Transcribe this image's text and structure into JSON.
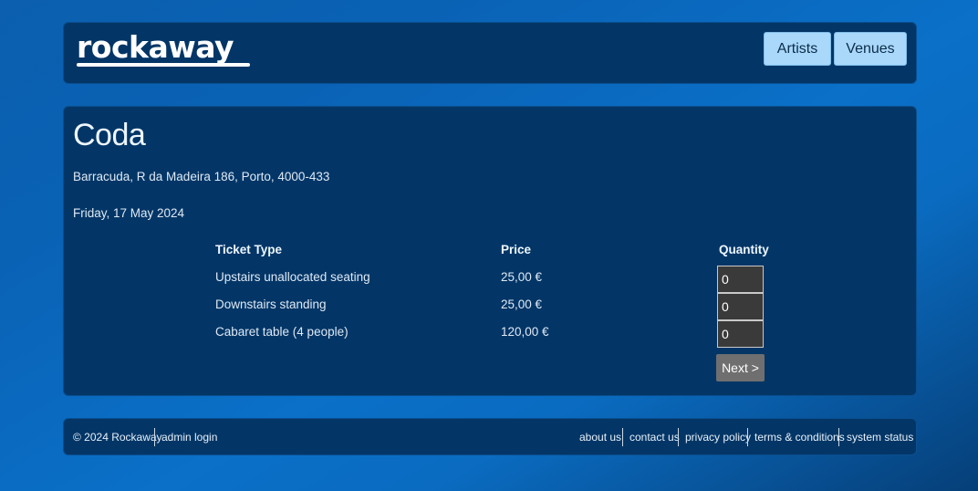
{
  "header": {
    "logo_text": "rockaway",
    "nav": [
      {
        "label": "Artists"
      },
      {
        "label": "Venues"
      }
    ]
  },
  "event": {
    "title": "Coda",
    "address": "Barracuda, R da Madeira 186, Porto, 4000-433",
    "date": "Friday, 17 May 2024"
  },
  "tickets": {
    "headers": {
      "type": "Ticket Type",
      "price": "Price",
      "quantity": "Quantity"
    },
    "rows": [
      {
        "type": "Upstairs unallocated seating",
        "price": "25,00 €",
        "quantity": "0"
      },
      {
        "type": "Downstairs standing",
        "price": "25,00 €",
        "quantity": "0"
      },
      {
        "type": "Cabaret table (4 people)",
        "price": "120,00 €",
        "quantity": "0"
      }
    ],
    "next_label": "Next >"
  },
  "footer": {
    "copyright": "© 2024 Rockaway",
    "admin_login": "admin login",
    "links": [
      "about us",
      "contact us",
      "privacy policy",
      "terms & conditions",
      "system status"
    ]
  },
  "colors": {
    "panel": "#033667",
    "nav_button": "#a9d8fb",
    "next_button": "#6f6f6f",
    "qty_input": "#3a3a3a"
  }
}
